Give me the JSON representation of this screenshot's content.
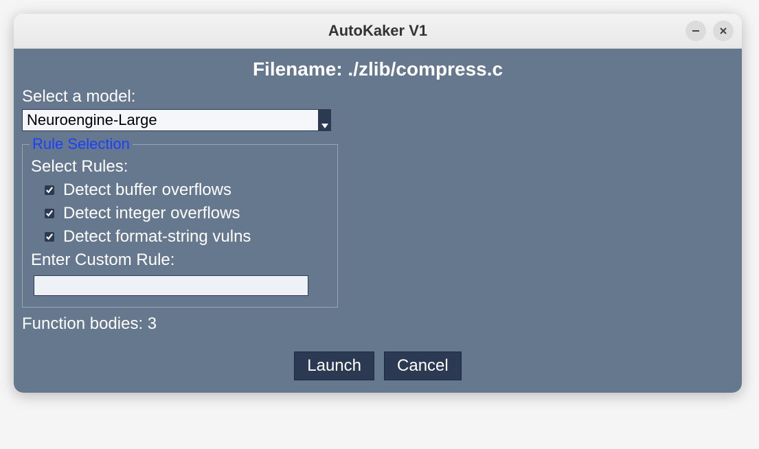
{
  "window": {
    "title": "AutoKaker V1"
  },
  "header": {
    "filename_label": "Filename: ./zlib/compress.c"
  },
  "model": {
    "label": "Select a model:",
    "selected": "Neuroengine-Large"
  },
  "rules": {
    "fieldset_title": "Rule Selection",
    "select_label": "Select Rules:",
    "items": [
      {
        "label": "Detect buffer overflows",
        "checked": true
      },
      {
        "label": "Detect integer overflows",
        "checked": true
      },
      {
        "label": "Detect format-string vulns",
        "checked": true
      }
    ],
    "custom_label": "Enter Custom Rule:",
    "custom_value": ""
  },
  "status": {
    "function_bodies": "Function bodies: 3"
  },
  "buttons": {
    "launch": "Launch",
    "cancel": "Cancel"
  }
}
